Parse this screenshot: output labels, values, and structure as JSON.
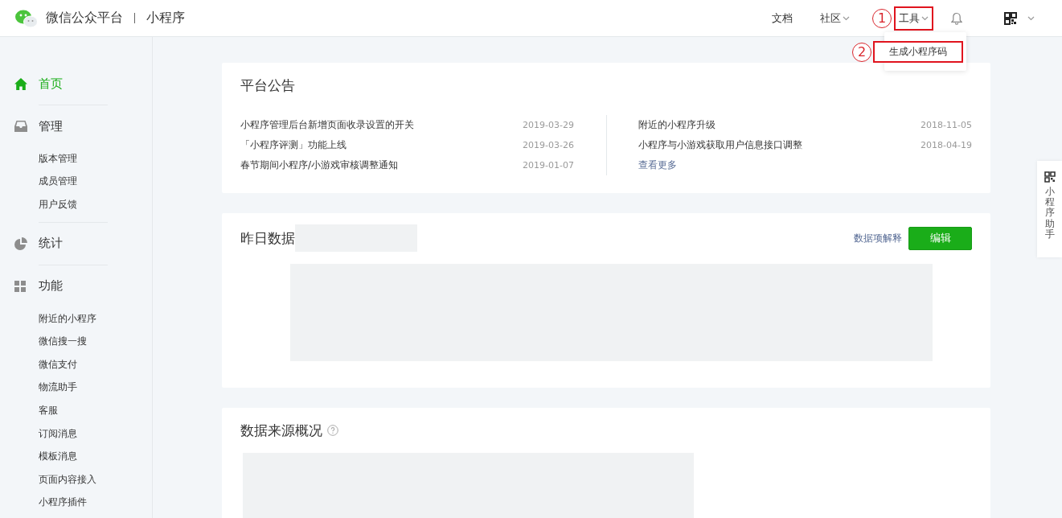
{
  "header": {
    "platform": "微信公众平台",
    "product": "小程序",
    "nav": [
      {
        "label": "文档",
        "kind": "link",
        "highlighted": false
      },
      {
        "label": "社区",
        "kind": "dropdown",
        "highlighted": false
      },
      {
        "label": "工具",
        "kind": "dropdown",
        "highlighted": true,
        "callout": "1"
      }
    ],
    "dropdown": {
      "items": [
        {
          "label": "生成小程序码",
          "highlighted": true,
          "callout": "2"
        }
      ]
    }
  },
  "sidebar": {
    "sections": [
      {
        "label": "首页",
        "selected": true
      },
      {
        "label": "管理",
        "selected": false,
        "items": [
          {
            "label": "版本管理",
            "selected": false
          },
          {
            "label": "成员管理",
            "selected": false
          },
          {
            "label": "用户反馈",
            "selected": false
          }
        ]
      },
      {
        "label": "统计",
        "selected": false
      },
      {
        "label": "功能",
        "selected": false,
        "items": [
          {
            "label": "附近的小程序",
            "selected": false
          },
          {
            "label": "微信搜一搜",
            "selected": false
          },
          {
            "label": "微信支付",
            "selected": false
          },
          {
            "label": "物流助手",
            "selected": false
          },
          {
            "label": "客服",
            "selected": false
          },
          {
            "label": "订阅消息",
            "selected": false
          },
          {
            "label": "模板消息",
            "selected": false
          },
          {
            "label": "页面内容接入",
            "selected": false
          },
          {
            "label": "小程序插件",
            "selected": false
          }
        ]
      }
    ]
  },
  "notices": {
    "title": "平台公告",
    "columns": [
      [
        {
          "title": "小程序管理后台新增页面收录设置的开关",
          "date": "2019-03-29"
        },
        {
          "title": "「小程序评测」功能上线",
          "date": "2019-03-26"
        },
        {
          "title": "春节期间小程序/小游戏审核调整通知",
          "date": "2019-01-07"
        }
      ],
      [
        {
          "title": "附近的小程序升级",
          "date": "2018-11-05"
        },
        {
          "title": "小程序与小游戏获取用户信息接口调整",
          "date": "2018-04-19"
        }
      ]
    ],
    "more": "查看更多"
  },
  "yesterday": {
    "title": "昨日数据",
    "help_link": "数据项解释",
    "button": "编辑"
  },
  "sources": {
    "title": "数据来源概况"
  },
  "helper": {
    "label": "小程序助手"
  }
}
